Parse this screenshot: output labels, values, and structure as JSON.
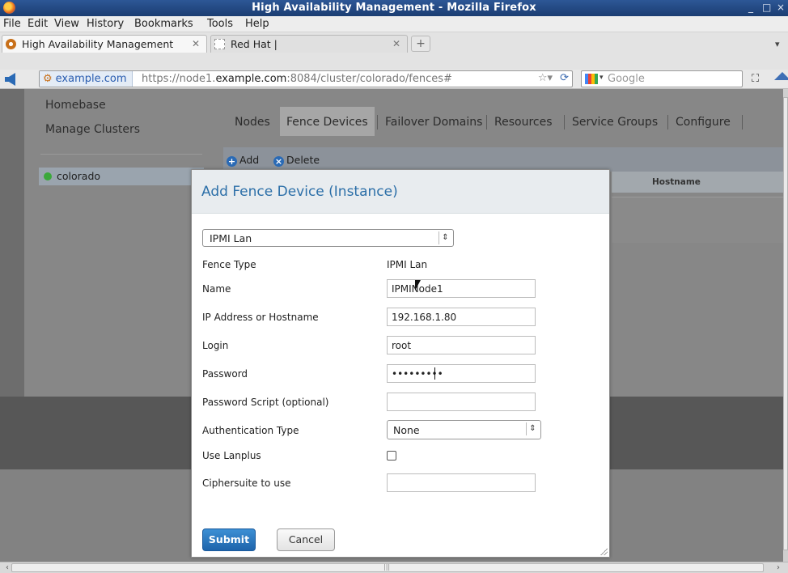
{
  "window": {
    "title": "High Availability Management - Mozilla Firefox",
    "controls": [
      "_",
      "□",
      "×"
    ]
  },
  "menubar": {
    "items": [
      {
        "label": "File"
      },
      {
        "label": "Edit"
      },
      {
        "label": "View"
      },
      {
        "label": "History"
      },
      {
        "label": "Bookmarks"
      },
      {
        "label": "Tools"
      },
      {
        "label": "Help"
      }
    ]
  },
  "tabs": [
    {
      "label": "High Availability Management",
      "close": "✕",
      "active": true
    },
    {
      "label": "Red Hat |",
      "close": "✕",
      "active": false
    }
  ],
  "navbar": {
    "site_identity": "example.com",
    "url_prefix": "https://node1.",
    "url_host": "example.com",
    "url_rest": ":8084/cluster/colorado/fences#",
    "search_placeholder": "Google"
  },
  "sidebar": {
    "items": [
      {
        "label": "Homebase"
      },
      {
        "label": "Manage Clusters"
      }
    ],
    "clusters": [
      {
        "label": "colorado",
        "status_color": "#3ba83b"
      }
    ]
  },
  "nav_tabs": [
    {
      "label": "Nodes",
      "active": false
    },
    {
      "label": "Fence Devices",
      "active": true
    },
    {
      "label": "Failover Domains",
      "active": false
    },
    {
      "label": "Resources",
      "active": false
    },
    {
      "label": "Service Groups",
      "active": false
    },
    {
      "label": "Configure",
      "active": false
    }
  ],
  "actions": {
    "add_label": "Add",
    "delete_label": "Delete"
  },
  "table": {
    "columns": [
      "Hostname"
    ]
  },
  "modal": {
    "title": "Add Fence Device (Instance)",
    "device_type": "IPMI Lan",
    "fields": {
      "fence_type": {
        "label": "Fence Type",
        "value": "IPMI Lan"
      },
      "name": {
        "label": "Name",
        "value": "IPMINode1"
      },
      "ip": {
        "label": "IP Address or Hostname",
        "value": "192.168.1.80"
      },
      "login": {
        "label": "Login",
        "value": "root"
      },
      "password": {
        "label": "Password",
        "value": "•••••••••"
      },
      "password_script": {
        "label": "Password Script (optional)",
        "value": ""
      },
      "auth_type": {
        "label": "Authentication Type",
        "value": "None"
      },
      "lanplus": {
        "label": "Use Lanplus",
        "checked": false
      },
      "ciphersuite": {
        "label": "Ciphersuite to use",
        "value": ""
      }
    },
    "submit_label": "Submit",
    "cancel_label": "Cancel"
  },
  "colors": {
    "accent": "#2c6fa8",
    "submit": "#1e64ab",
    "status_ok": "#3ba83b"
  }
}
